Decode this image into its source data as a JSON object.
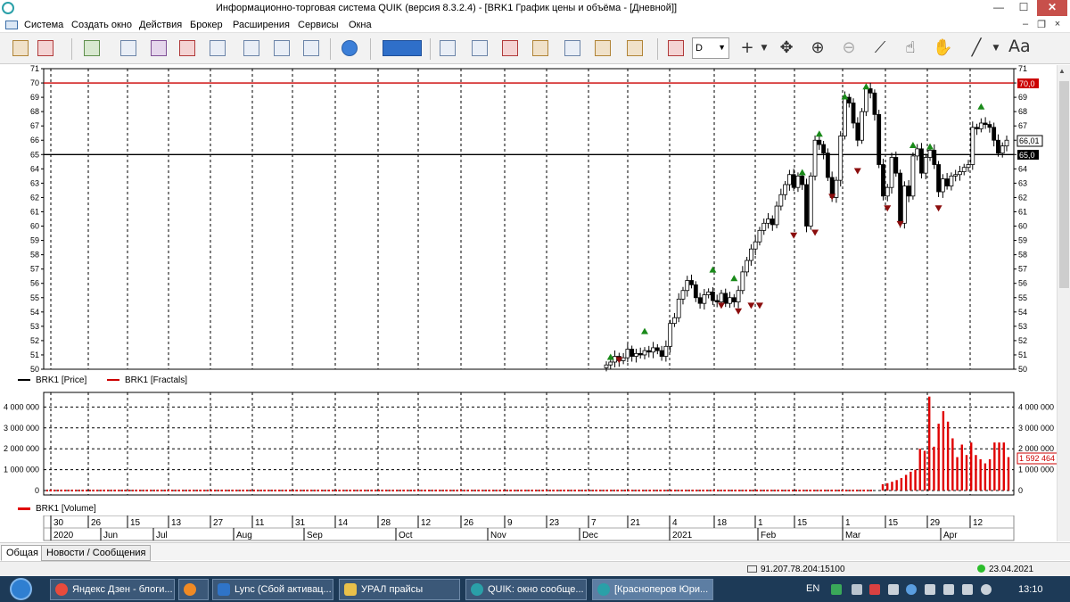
{
  "window": {
    "title": "Информационно-торговая система QUIK (версия 8.3.2.4) - [BRK1 График цены и объёма - [Дневной]]",
    "min_icon": "minimize-icon",
    "max_icon": "maximize-icon",
    "close_icon": "close-icon"
  },
  "menu": {
    "items": [
      "Система",
      "Создать окно",
      "Действия",
      "Брокер",
      "Расширения",
      "Сервисы",
      "Окна"
    ],
    "mdi_min": "–",
    "mdi_restore": "❐",
    "mdi_close": "×"
  },
  "toolbar": {
    "period_value": "D",
    "font_button": "Aa",
    "icons": [
      "key-icon",
      "new-chart-icon",
      "chart-window-icon",
      "chart-table-icon",
      "table-window-icon",
      "deals-icon",
      "search-quotes-icon",
      "delete-icon",
      "info-icon",
      "ticker-icon",
      "orders-icon",
      "stop-orders-icon",
      "money-orders-icon",
      "coins-icon",
      "copy-icon",
      "portfolio-icon",
      "money-portfolio-icon",
      "bar-chart-icon",
      "crosshair-icon",
      "move-icon",
      "zoom-in-icon",
      "zoom-out-icon",
      "ruler-icon",
      "pointer-icon",
      "hand-icon",
      "line-tool-icon"
    ]
  },
  "price_chart": {
    "legend": [
      {
        "name": "BRK1 [Price]",
        "color": "#000000"
      },
      {
        "name": "BRK1 [Fractals]",
        "color": "#cc0000"
      }
    ],
    "current_price_label": "66,01",
    "resistance_label": "70,0",
    "support_label": "65,0"
  },
  "volume_chart": {
    "legend": [
      {
        "name": "BRK1 [Volume]",
        "color": "#e00000"
      }
    ],
    "current_volume_label": "1 592 464"
  },
  "chart_data": [
    {
      "type": "candlestick",
      "series_name": "BRK1 [Price]",
      "ylim": [
        50,
        71
      ],
      "y_ticks": [
        50,
        51,
        52,
        53,
        54,
        55,
        56,
        57,
        58,
        59,
        60,
        61,
        62,
        63,
        64,
        65,
        66,
        67,
        68,
        69,
        70,
        71
      ],
      "horizontal_lines": [
        {
          "value": 70.0,
          "color": "#cc0000",
          "label": "70,0"
        },
        {
          "value": 65.0,
          "color": "#000000",
          "label": "65,0"
        }
      ],
      "last_value": 66.01,
      "close": [
        50.3,
        50.5,
        50.9,
        50.6,
        50.8,
        51.4,
        50.9,
        51.1,
        51.0,
        51.3,
        51.2,
        51.5,
        51.3,
        50.9,
        51.6,
        53.2,
        53.6,
        54.9,
        55.5,
        56.2,
        55.9,
        55.0,
        54.6,
        55.2,
        55.4,
        54.8,
        54.7,
        55.3,
        54.6,
        55.0,
        54.7,
        55.5,
        56.8,
        57.6,
        58.4,
        58.9,
        59.7,
        60.2,
        60.5,
        60.1,
        61.4,
        62.2,
        62.9,
        63.6,
        62.7,
        63.5,
        62.9,
        60.0,
        63.5,
        66.0,
        65.7,
        65.1,
        63.4,
        62.0,
        63.2,
        66.3,
        69.0,
        68.6,
        67.2,
        66.0,
        68.0,
        69.6,
        69.3,
        67.8,
        64.3,
        62.1,
        62.7,
        64.8,
        63.7,
        60.2,
        62.8,
        62.1,
        64.9,
        65.4,
        63.7,
        64.8,
        65.3,
        64.3,
        62.4,
        63.3,
        62.8,
        63.5,
        63.6,
        63.8,
        64.1,
        64.3,
        66.9,
        66.8,
        67.2,
        67.1,
        66.9,
        66.0,
        65.1,
        65.6,
        66.0
      ],
      "fractals_up": [
        50.9,
        52.7,
        57.0,
        56.4,
        63.8,
        66.5,
        69.1,
        69.8,
        65.7,
        65.6,
        68.4
      ],
      "fractals_down": [
        50.6,
        54.4,
        54.0,
        54.4,
        54.4,
        59.3,
        59.5,
        62.0,
        63.8,
        61.2,
        60.1,
        61.2
      ]
    },
    {
      "type": "bar",
      "series_name": "BRK1 [Volume]",
      "ylim": [
        0,
        4700000
      ],
      "y_ticks": [
        0,
        1000000,
        2000000,
        3000000,
        4000000
      ],
      "y_tick_labels": [
        "0",
        "1 000 000",
        "2 000 000",
        "3 000 000",
        "4 000 000"
      ],
      "last_value": 1592464,
      "values": [
        300000,
        350000,
        420000,
        500000,
        600000,
        750000,
        900000,
        1000000,
        2000000,
        1900000,
        4500000,
        2100000,
        3200000,
        3800000,
        3300000,
        2500000,
        1600000,
        2200000,
        1700000,
        2300000,
        1700000,
        1500000,
        1300000,
        1500000,
        2300000,
        2300000,
        2300000,
        1600000
      ]
    }
  ],
  "time_axis": {
    "days": [
      "30",
      "26",
      "15",
      "13",
      "27",
      "11",
      "31",
      "14",
      "28",
      "12",
      "26",
      "9",
      "23",
      "7",
      "21",
      "4",
      "18",
      "1",
      "15",
      "1",
      "15",
      "29",
      "12"
    ],
    "months": [
      "2020",
      "Jun",
      "Jul",
      "Aug",
      "Sep",
      "Oct",
      "Nov",
      "Dec",
      "2021",
      "Feb",
      "Mar",
      "Apr"
    ]
  },
  "tabs": [
    "Общая",
    "Новости / Сообщения"
  ],
  "status": {
    "connection": "91.207.78.204:15100",
    "date": "23.04.2021"
  },
  "taskbar": {
    "items": [
      "Яндекс Дзен - блоги...",
      "Lync (Сбой активац...",
      "УРАЛ прайсы",
      "QUIK: окно сообще...",
      "[Красноперов Юри..."
    ],
    "language": "EN",
    "clock": "13:10"
  }
}
